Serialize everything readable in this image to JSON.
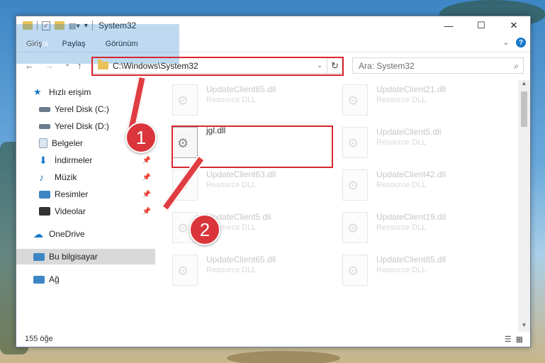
{
  "window": {
    "title": "System32"
  },
  "window_controls": {
    "minimize": "—",
    "maximize": "☐",
    "close": "✕"
  },
  "ribbon": {
    "tabs": [
      "Dosya",
      "Giriş",
      "Paylaş",
      "Görünüm"
    ]
  },
  "nav": {
    "back": "←",
    "forward": "→",
    "recent": "⌄",
    "up": "↑"
  },
  "address": {
    "path": "C:\\Windows\\System32"
  },
  "search": {
    "placeholder": "Ara: System32"
  },
  "sidebar": {
    "items": [
      {
        "label": "Hızlı erişim",
        "color": "#1979ca"
      },
      {
        "label": "Yerel Disk (C:)",
        "color": "#6a7b8c"
      },
      {
        "label": "Yerel Disk (D:)",
        "color": "#6a7b8c"
      },
      {
        "label": "Belgeler",
        "color": "#8fa3b8"
      },
      {
        "label": "İndirmeler",
        "color": "#1979ca"
      },
      {
        "label": "Müzik",
        "color": "#2c76c6"
      },
      {
        "label": "Resimler",
        "color": "#3d86c6"
      },
      {
        "label": "Videolar",
        "color": "#333333"
      },
      {
        "label": "OneDrive",
        "color": "#1979ca"
      },
      {
        "label": "Bu bilgisayar",
        "color": "#3d86c6"
      },
      {
        "label": "Ağ",
        "color": "#3d86c6"
      }
    ]
  },
  "files": [
    {
      "name": "UpdateClient65.dll",
      "type": "Resource DLL"
    },
    {
      "name": "UpdateClient21.dll",
      "type": "Resource DLL"
    },
    {
      "name": "jgl.dll",
      "type": ""
    },
    {
      "name": "UpdateClient5.dll",
      "type": "Resource DLL"
    },
    {
      "name": "UpdateClient63.dll",
      "type": "Resource DLL"
    },
    {
      "name": "UpdateClient42.dll",
      "type": "Resource DLL"
    },
    {
      "name": "UpdateClient5.dll",
      "type": "Resource DLL"
    },
    {
      "name": "UpdateClient19.dll",
      "type": "Resource DLL"
    },
    {
      "name": "UpdateClient65.dll",
      "type": "Resource DLL"
    },
    {
      "name": "UpdateClient65.dll",
      "type": "Resource DLL"
    }
  ],
  "status": {
    "count": "155 öğe"
  },
  "annotations": {
    "step1": "1",
    "step2": "2",
    "color": "#d9262e"
  }
}
